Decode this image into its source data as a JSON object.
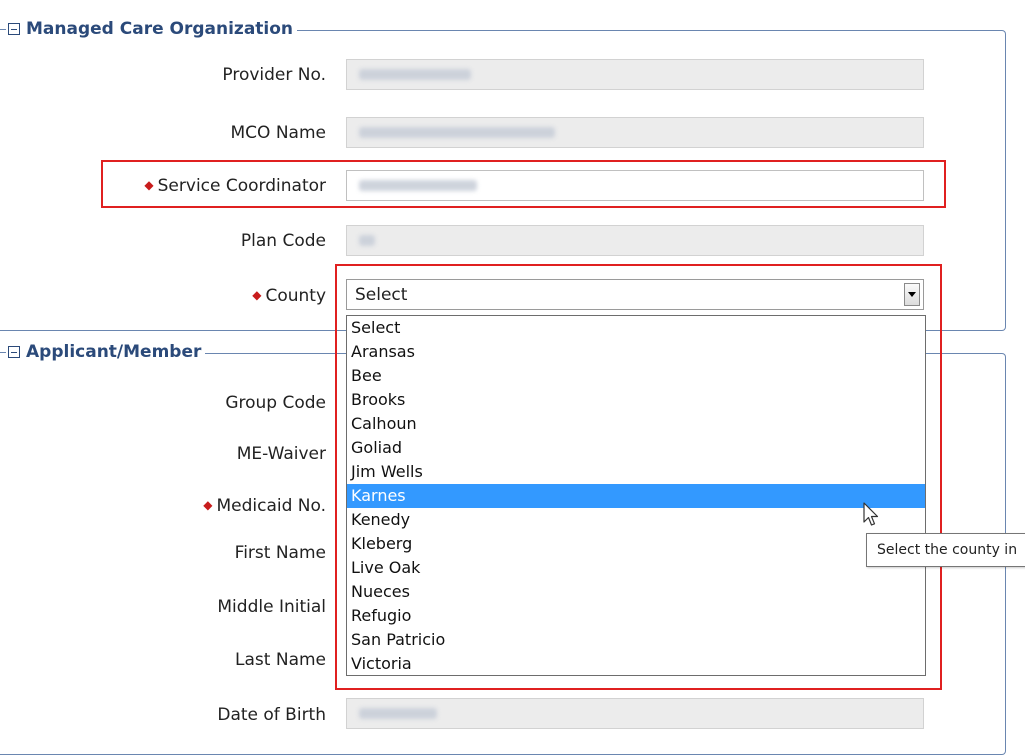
{
  "sections": {
    "mco": {
      "title": "Managed Care Organization"
    },
    "applicant": {
      "title": "Applicant/Member"
    }
  },
  "mco_fields": {
    "provider_no": {
      "label": "Provider No."
    },
    "mco_name": {
      "label": "MCO Name"
    },
    "service_coordinator": {
      "label": "Service Coordinator",
      "required": true
    },
    "plan_code": {
      "label": "Plan Code"
    },
    "county": {
      "label": "County",
      "required": true,
      "selected": "Select"
    }
  },
  "applicant_fields": {
    "group_code": {
      "label": "Group Code"
    },
    "me_waiver": {
      "label": "ME-Waiver"
    },
    "medicaid_no": {
      "label": "Medicaid No.",
      "required": true
    },
    "first_name": {
      "label": "First Name"
    },
    "middle_initial": {
      "label": "Middle Initial"
    },
    "last_name": {
      "label": "Last Name"
    },
    "date_of_birth": {
      "label": "Date of Birth"
    }
  },
  "county_dropdown": {
    "options": [
      "Select",
      "Aransas",
      "Bee",
      "Brooks",
      "Calhoun",
      "Goliad",
      "Jim Wells",
      "Karnes",
      "Kenedy",
      "Kleberg",
      "Live Oak",
      "Nueces",
      "Refugio",
      "San Patricio",
      "Victoria"
    ],
    "highlighted": "Karnes"
  },
  "tooltip": {
    "text": "Select the county in"
  },
  "colors": {
    "highlight": "#3399ff",
    "required_marker": "#c81c1c",
    "annotation_box": "#e02020",
    "section_title": "#2b4a7a"
  }
}
